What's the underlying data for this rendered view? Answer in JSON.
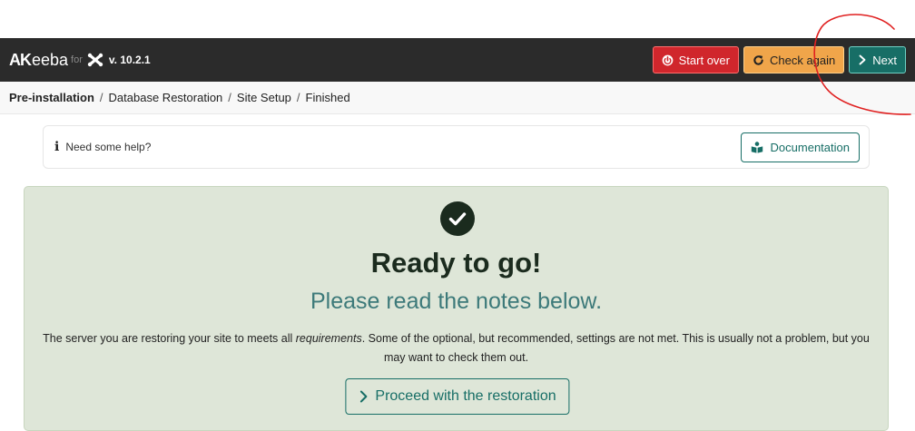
{
  "brand": {
    "logo_ak": "AK",
    "logo_eeba": "eeba",
    "logo_for": "for",
    "version": "v. 10.2.1"
  },
  "toolbar": {
    "start_over_label": "Start over",
    "check_again_label": "Check again",
    "next_label": "Next"
  },
  "breadcrumb": {
    "items": [
      "Pre-installation",
      "Database Restoration",
      "Site Setup",
      "Finished"
    ],
    "separator": "/"
  },
  "help": {
    "text": "Need some help?",
    "documentation_label": "Documentation"
  },
  "status": {
    "title": "Ready to go!",
    "subtitle": "Please read the notes below.",
    "desc_part1": "The server you are restoring your site to meets all ",
    "desc_emphasis": "requirements",
    "desc_part2": ". Some of the optional, but recommended, settings are not met. This is usually not a problem, but you may want to check them out.",
    "proceed_label": "Proceed with the restoration"
  },
  "colors": {
    "topbar": "#2b2b2b",
    "start_over": "#d0262c",
    "check_again": "#f0a54a",
    "next": "#176e66",
    "panel": "#dee6d8",
    "subtitle": "#3d7a7a",
    "annotation": "#e02020"
  },
  "icons": {
    "start_over": "power-icon",
    "check_again": "refresh-icon",
    "next": "chevron-right-icon",
    "help": "info-icon",
    "documentation": "book-reader-icon",
    "status": "check-circle-icon",
    "proceed": "chevron-right-icon"
  }
}
